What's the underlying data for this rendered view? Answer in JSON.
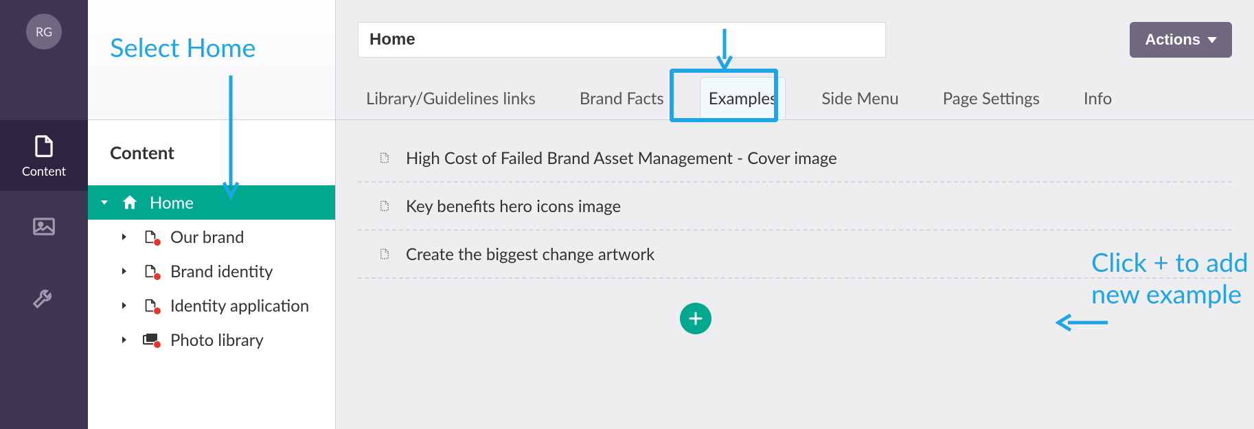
{
  "rail": {
    "avatar_initials": "RG",
    "items": {
      "content_label": "Content"
    }
  },
  "sidebar": {
    "title": "Content",
    "tree": {
      "root": "Home",
      "children": [
        "Our brand",
        "Brand identity",
        "Identity application",
        "Photo library"
      ]
    }
  },
  "header": {
    "page_title": "Home",
    "actions_label": "Actions"
  },
  "tabs": [
    "Library/Guidelines links",
    "Brand Facts",
    "Examples",
    "Side Menu",
    "Page Settings",
    "Info"
  ],
  "active_tab_index": 2,
  "examples": [
    "High Cost of Failed Brand Asset Management - Cover image",
    "Key benefits hero icons image",
    "Create the biggest change artwork"
  ],
  "annotations": {
    "select_home": "Select Home",
    "add_example_line1": "Click + to add a",
    "add_example_line2": "new example"
  }
}
